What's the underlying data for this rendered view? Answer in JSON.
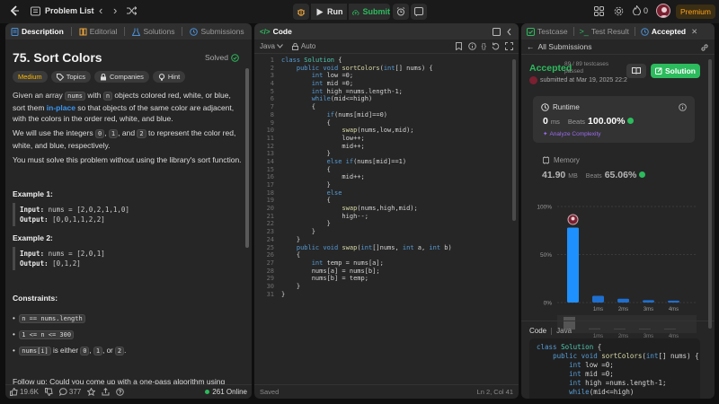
{
  "topbar": {
    "problem_list": "Problem List",
    "run": "Run",
    "submit": "Submit",
    "coins": "0",
    "premium": "Premium"
  },
  "desc": {
    "tabs": [
      "Description",
      "Editorial",
      "Solutions",
      "Submissions"
    ],
    "title": "75. Sort Colors",
    "status": "Solved",
    "difficulty": "Medium",
    "pills": [
      "Topics",
      "Companies",
      "Hint"
    ],
    "p1a": "Given an array ",
    "p1code": "nums",
    "p1b": " with ",
    "p1code2": "n",
    "p1c": " objects colored red, white, or blue, sort them ",
    "p1link": "in-place",
    "p1d": " so that objects of the same color are adjacent, with the colors in the order red, white, and blue.",
    "p2a": "We will use the integers ",
    "p2c0": "0",
    "p2b": ", ",
    "p2c1": "1",
    "p2c": ", and ",
    "p2c2": "2",
    "p2d": " to represent the color red, white, and blue, respectively.",
    "p3": "You must solve this problem without using the library's sort function.",
    "ex1_title": "Example 1:",
    "ex1_in_label": "Input:",
    "ex1_in": " nums = [2,0,2,1,1,0]",
    "ex1_out_label": "Output:",
    "ex1_out": " [0,0,1,1,2,2]",
    "ex2_title": "Example 2:",
    "ex2_in_label": "Input:",
    "ex2_in": " nums = [2,0,1]",
    "ex2_out_label": "Output:",
    "ex2_out": " [0,1,2]",
    "constraints_title": "Constraints:",
    "c1": "n == nums.length",
    "c2": "1 <= n <= 300",
    "c3a": "nums[i]",
    "c3b": " is either ",
    "c3c0": "0",
    "c3d": ", ",
    "c3c1": "1",
    "c3e": ", or ",
    "c3c2": "2",
    "c3f": ".",
    "followup": "Follow up: Could you come up with a one-pass algorithm using",
    "likes": "19.6K",
    "comments": "377",
    "online": "261 Online"
  },
  "code": {
    "tab": "Code",
    "lang": "Java",
    "auto": "Auto",
    "saved": "Saved",
    "cursor": "Ln 2, Col 41",
    "lines": [
      "class Solution {",
      "    public void sortColors(int[] nums) {",
      "        int low =0;",
      "        int mid =0;",
      "        int high =nums.length-1;",
      "        while(mid<=high)",
      "        {",
      "            if(nums[mid]==0)",
      "            {",
      "                swap(nums,low,mid);",
      "                low++;",
      "                mid++;",
      "            }",
      "            else if(nums[mid]==1)",
      "            {",
      "                mid++;",
      "            }",
      "            else",
      "            {",
      "                swap(nums,high,mid);",
      "                high--;",
      "            }",
      "        }",
      "    }",
      "    public void swap(int[]nums, int a, int b)",
      "    {",
      "        int temp = nums[a];",
      "        nums[a] = nums[b];",
      "        nums[b] = temp;",
      "    }",
      "}"
    ]
  },
  "result": {
    "tabs": [
      "Testcase",
      "Test Result",
      "Accepted"
    ],
    "back": "All Submissions",
    "accepted": "Accepted",
    "passed": "89 / 89 testcases passed",
    "submitted": "submitted at Mar 19, 2025 22:2",
    "solution_btn": "Solution",
    "runtime_label": "Runtime",
    "runtime_val": "0",
    "runtime_unit": "ms",
    "beats_label": "Beats",
    "runtime_beats": "100.00%",
    "analyze": "Analyze Complexity",
    "memory_label": "Memory",
    "memory_val": "41.90",
    "memory_unit": "MB",
    "memory_beats": "65.06%",
    "code_label": "Code",
    "code_lang": "Java",
    "preview": [
      "class Solution {",
      "    public void sortColors(int[] nums) {",
      "        int low =0;",
      "        int mid =0;",
      "        int high =nums.length-1;",
      "        while(mid<=high)"
    ]
  },
  "chart_data": {
    "type": "bar",
    "ylabels": [
      "100%",
      "50%",
      "0%"
    ],
    "categories": [
      "",
      "1ms",
      "2ms",
      "3ms",
      "4ms"
    ],
    "values": [
      78,
      7,
      4,
      2.5,
      2
    ],
    "ylim": [
      0,
      100
    ],
    "mini_labels": [
      "",
      "1ms",
      "2ms",
      "3ms",
      "4ms"
    ]
  }
}
